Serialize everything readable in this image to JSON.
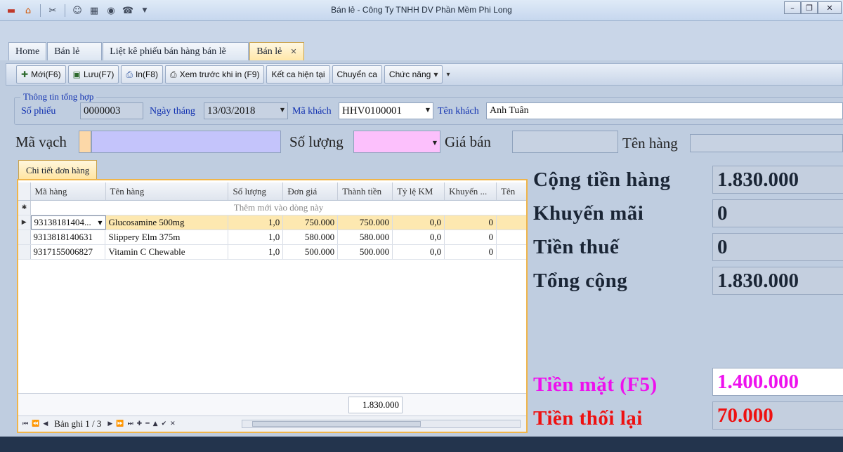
{
  "window": {
    "title": "Bán lẻ - Công Ty TNHH DV Phần Mềm Phi Long"
  },
  "tabs": [
    {
      "label": "Home"
    },
    {
      "label": "Bán lẻ"
    },
    {
      "label": "Liệt kê phiếu bán hàng bán lẽ"
    },
    {
      "label": "Bán lẻ",
      "active": true
    }
  ],
  "toolbar": {
    "new": "Mới(F6)",
    "save": "Lưu(F7)",
    "print": "In(F8)",
    "preview": "Xem trước khi in (F9)",
    "close_shift": "Kết ca hiện tại",
    "transfer_shift": "Chuyển ca",
    "functions": "Chức năng"
  },
  "summary": {
    "legend": "Thông tin tổng hợp",
    "so_phieu_label": "Số phiếu",
    "so_phieu": "0000003",
    "ngay_thang_label": "Ngày tháng",
    "ngay_thang": "13/03/2018",
    "ma_khach_label": "Mã khách",
    "ma_khach": "HHV0100001",
    "ten_khach_label": "Tên khách",
    "ten_khach": "Anh Tuân"
  },
  "scan": {
    "ma_vach_label": "Mã vạch",
    "so_luong_label": "Số lượng",
    "gia_ban_label": "Giá bán",
    "ten_hang_label": "Tên hàng"
  },
  "grid": {
    "tab_label": "Chi tiết đơn hàng",
    "columns": [
      "Mã hàng",
      "Tên hàng",
      "Số lượng",
      "Đơn giá",
      "Thành tiền",
      "Tỷ lệ KM",
      "Khuyến ...",
      "Tên"
    ],
    "new_row_text": "Thêm mới vào dòng này",
    "rows": [
      {
        "ma_hang": "93138181404...",
        "ten_hang": "Glucosamine 500mg",
        "so_luong": "1,0",
        "don_gia": "750.000",
        "thanh_tien": "750.000",
        "ty_le_km": "0,0",
        "khuyen_mai": "0"
      },
      {
        "ma_hang": "9313818140631",
        "ten_hang": "Slippery Elm 375m",
        "so_luong": "1,0",
        "don_gia": "580.000",
        "thanh_tien": "580.000",
        "ty_le_km": "0,0",
        "khuyen_mai": "0"
      },
      {
        "ma_hang": "9317155006827",
        "ten_hang": "Vitamin C Chewable",
        "so_luong": "1,0",
        "don_gia": "500.000",
        "thanh_tien": "500.000",
        "ty_le_km": "0,0",
        "khuyen_mai": "0"
      }
    ],
    "total": "1.830.000",
    "record_text": "Bản ghi 1 / 3"
  },
  "totals": {
    "cong_tien_hang_label": "Cộng tiền hàng",
    "cong_tien_hang": "1.830.000",
    "khuyen_mai_label": "Khuyến mãi",
    "khuyen_mai": "0",
    "tien_thue_label": "Tiền thuế",
    "tien_thue": "0",
    "tong_cong_label": "Tổng cộng",
    "tong_cong": "1.830.000",
    "tien_mat_label": "Tiền mặt (F5)",
    "tien_mat": "1.400.000",
    "tien_thoi_lai_label": "Tiền thối lại",
    "tien_thoi_lai": "70.000"
  },
  "colors": {
    "cash_label": "#ee10ee",
    "change_label": "#ee1111"
  }
}
